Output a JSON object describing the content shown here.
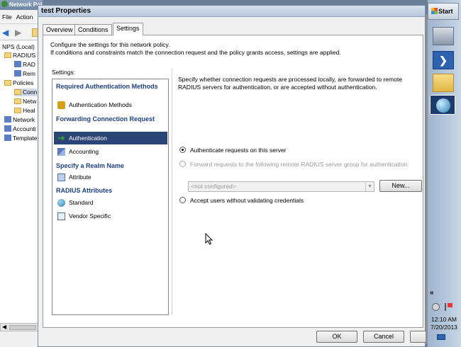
{
  "background_window": {
    "title": "Network Policy Server",
    "menu": [
      "File",
      "Action"
    ],
    "tree": [
      {
        "label": "NPS (Local)"
      },
      {
        "label": "RADIUS"
      },
      {
        "label": "RAD"
      },
      {
        "label": "Rem"
      },
      {
        "label": "Policies"
      },
      {
        "label": "Conn"
      },
      {
        "label": "Netw"
      },
      {
        "label": "Heal"
      },
      {
        "label": "Network"
      },
      {
        "label": "Accounti"
      },
      {
        "label": "Template"
      }
    ]
  },
  "dialog": {
    "title": "test Properties",
    "tabs": [
      {
        "label": "Overview",
        "active": false
      },
      {
        "label": "Conditions",
        "active": false
      },
      {
        "label": "Settings",
        "active": true
      }
    ],
    "description_line1": "Configure the settings for this network policy.",
    "description_line2": "If conditions and constraints match the connection request and the policy grants access, settings are applied.",
    "settings_label": "Settings:",
    "nav": {
      "header1": "Required Authentication Methods",
      "item_auth_methods": "Authentication Methods",
      "header2": "Forwarding Connection Request",
      "item_authentication": "Authentication",
      "item_accounting": "Accounting",
      "header3": "Specify a Realm Name",
      "item_attribute": "Attribute",
      "header4": "RADIUS Attributes",
      "item_standard": "Standard",
      "item_vendor": "Vendor Specific"
    },
    "right": {
      "description": "Specify whether connection requests are processed locally, are forwarded to remote RADIUS servers for authentication, or are accepted without authentication.",
      "option1": "Authenticate requests on this server",
      "option2": "Forward requests to the following remote RADIUS server group for authentication:",
      "combo_value": "<not configured>",
      "new_button": "New...",
      "option3": "Accept users without validating credentials"
    },
    "footer": {
      "ok": "OK",
      "cancel": "Cancel"
    }
  },
  "taskbar": {
    "start": "Start",
    "chevron": "«",
    "time": "12:10 AM",
    "date": "7/20/2013"
  }
}
